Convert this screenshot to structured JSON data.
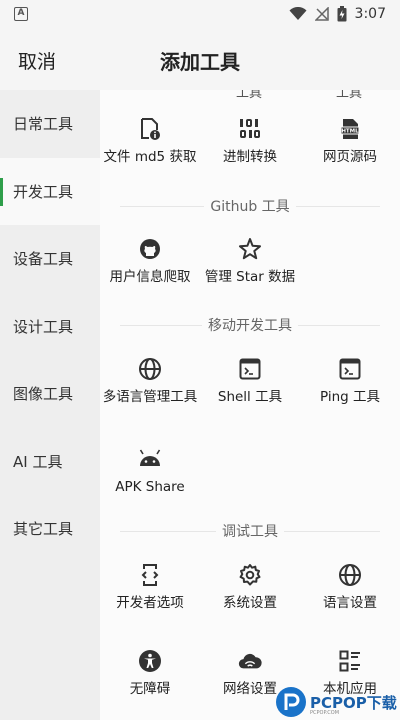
{
  "status": {
    "time": "3:07",
    "badge": "A"
  },
  "header": {
    "cancel": "取消",
    "title": "添加工具"
  },
  "sidebar": {
    "items": [
      {
        "label": "日常工具"
      },
      {
        "label": "开发工具"
      },
      {
        "label": "设备工具"
      },
      {
        "label": "设计工具"
      },
      {
        "label": "图像工具"
      },
      {
        "label": "AI 工具"
      },
      {
        "label": "其它工具"
      }
    ],
    "active_index": 1
  },
  "content": {
    "cutoff": [
      "工具",
      "工具"
    ],
    "row1": [
      {
        "label": "文件 md5 获取",
        "icon": "file-info-icon"
      },
      {
        "label": "进制转换",
        "icon": "binary-icon"
      },
      {
        "label": "网页源码",
        "icon": "html-file-icon"
      }
    ],
    "sections": {
      "github": "Github 工具",
      "mobile": "移动开发工具",
      "debug": "调试工具"
    },
    "github_tools": [
      {
        "label": "用户信息爬取",
        "icon": "github-icon"
      },
      {
        "label": "管理 Star 数据",
        "icon": "star-icon"
      }
    ],
    "mobile_tools": [
      {
        "label": "多语言管理工具",
        "icon": "globe-icon"
      },
      {
        "label": "Shell 工具",
        "icon": "terminal-icon"
      },
      {
        "label": "Ping 工具",
        "icon": "terminal-icon"
      }
    ],
    "mobile_tools_2": [
      {
        "label": "APK Share",
        "icon": "android-icon"
      }
    ],
    "debug_tools": [
      {
        "label": "开发者选项",
        "icon": "developer-phone-icon"
      },
      {
        "label": "系统设置",
        "icon": "gear-icon"
      },
      {
        "label": "语言设置",
        "icon": "globe-icon"
      }
    ],
    "debug_tools_2": [
      {
        "label": "无障碍",
        "icon": "accessibility-icon"
      },
      {
        "label": "网络设置",
        "icon": "wifi-cloud-icon"
      },
      {
        "label": "本机应用",
        "icon": "app-list-icon"
      }
    ]
  },
  "watermark": {
    "text": "PCPOP下载",
    "sub": "PCPOP.COM"
  },
  "colors": {
    "accent": "#2e9e4a",
    "sidebar_bg": "#eeeeee",
    "content_bg": "#fbfbfb"
  }
}
